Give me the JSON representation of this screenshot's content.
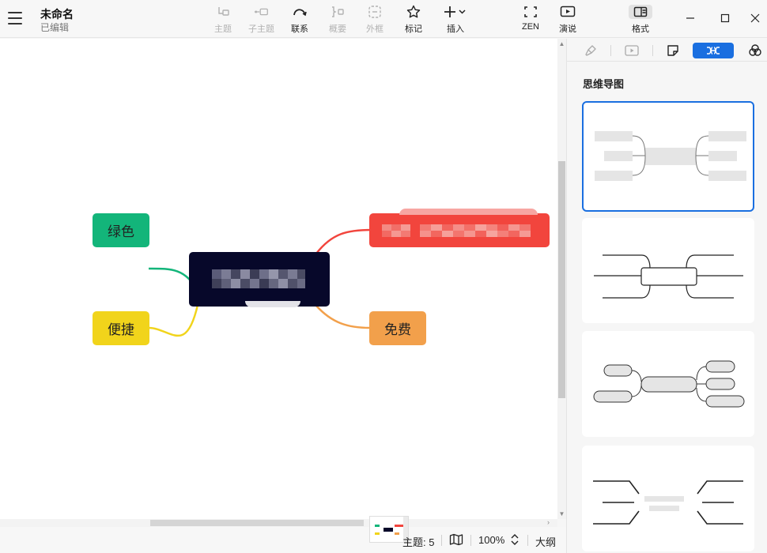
{
  "document": {
    "title": "未命名",
    "status": "已编辑"
  },
  "toolbar": {
    "topic": "主题",
    "subtopic": "子主题",
    "relationship": "联系",
    "summary": "概要",
    "boundary": "外框",
    "marker": "标记",
    "insert": "插入",
    "zen": "ZEN",
    "present": "演说",
    "format": "格式"
  },
  "mindmap": {
    "nodes": [
      {
        "label": "绿色",
        "color": "#13b57a"
      },
      {
        "label": "便捷",
        "color": "#f1d41b"
      },
      {
        "label": "免费",
        "color": "#f2a04b"
      }
    ],
    "central_color": "#07082a",
    "top_right_color": "#f2453d"
  },
  "statusbar": {
    "topics": "主题: 5",
    "zoom": "100%",
    "outline": "大纲"
  },
  "panel": {
    "heading": "思维导图",
    "active_tab_color": "#1a6fe0",
    "tabs": [
      "brush-icon",
      "play-icon",
      "sticker-icon",
      "mindmap-structure-icon",
      "theme-icon"
    ]
  }
}
